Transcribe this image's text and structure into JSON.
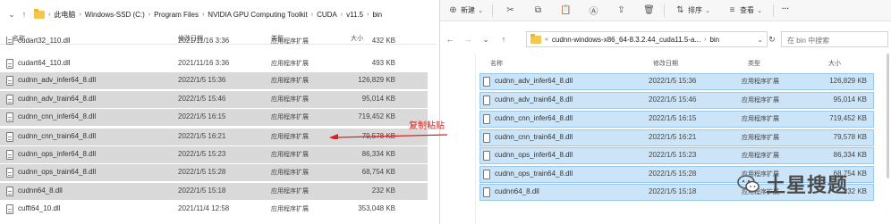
{
  "left": {
    "breadcrumb": [
      "此电脑",
      "Windows-SSD (C:)",
      "Program Files",
      "NVIDIA GPU Computing Toolkit",
      "CUDA",
      "v11.5",
      "bin"
    ],
    "headers": {
      "name": "名称",
      "date": "修改日期",
      "type": "类型",
      "size": "大小"
    },
    "rows": [
      {
        "name": "cudart32_110.dll",
        "date": "2021/11/16 3:36",
        "type": "应用程序扩展",
        "size": "432 KB",
        "selected": false
      },
      {
        "name": "cudart64_110.dll",
        "date": "2021/11/16 3:36",
        "type": "应用程序扩展",
        "size": "493 KB",
        "selected": false
      },
      {
        "name": "cudnn_adv_infer64_8.dll",
        "date": "2022/1/5 15:36",
        "type": "应用程序扩展",
        "size": "126,829 KB",
        "selected": true
      },
      {
        "name": "cudnn_adv_train64_8.dll",
        "date": "2022/1/5 15:46",
        "type": "应用程序扩展",
        "size": "95,014 KB",
        "selected": true
      },
      {
        "name": "cudnn_cnn_infer64_8.dll",
        "date": "2022/1/5 16:15",
        "type": "应用程序扩展",
        "size": "719,452 KB",
        "selected": true
      },
      {
        "name": "cudnn_cnn_train64_8.dll",
        "date": "2022/1/5 16:21",
        "type": "应用程序扩展",
        "size": "79,578 KB",
        "selected": true
      },
      {
        "name": "cudnn_ops_infer64_8.dll",
        "date": "2022/1/5 15:23",
        "type": "应用程序扩展",
        "size": "86,334 KB",
        "selected": true
      },
      {
        "name": "cudnn_ops_train64_8.dll",
        "date": "2022/1/5 15:28",
        "type": "应用程序扩展",
        "size": "68,754 KB",
        "selected": true
      },
      {
        "name": "cudnn64_8.dll",
        "date": "2022/1/5 15:18",
        "type": "应用程序扩展",
        "size": "232 KB",
        "selected": true
      },
      {
        "name": "cufft64_10.dll",
        "date": "2021/11/4 12:58",
        "type": "应用程序扩展",
        "size": "353,048 KB",
        "selected": false
      }
    ]
  },
  "annotation": {
    "label": "复制粘贴",
    "color": "#e0201f"
  },
  "right": {
    "toolbar": {
      "new_label": "新建",
      "sort_label": "排序",
      "view_label": "查看",
      "more_label": "···"
    },
    "address": [
      "cudnn-windows-x86_64-8.3.2.44_cuda11.5-a...",
      "bin"
    ],
    "search_placeholder": "在 bin 中搜索",
    "headers": {
      "name": "名称",
      "date": "修改日期",
      "type": "类型",
      "size": "大小"
    },
    "rows": [
      {
        "name": "cudnn_adv_infer64_8.dll",
        "date": "2022/1/5 15:36",
        "type": "应用程序扩展",
        "size": "126,829 KB"
      },
      {
        "name": "cudnn_adv_train64_8.dll",
        "date": "2022/1/5 15:46",
        "type": "应用程序扩展",
        "size": "95,014 KB"
      },
      {
        "name": "cudnn_cnn_infer64_8.dll",
        "date": "2022/1/5 16:15",
        "type": "应用程序扩展",
        "size": "719,452 KB"
      },
      {
        "name": "cudnn_cnn_train64_8.dll",
        "date": "2022/1/5 16:21",
        "type": "应用程序扩展",
        "size": "79,578 KB"
      },
      {
        "name": "cudnn_ops_infer64_8.dll",
        "date": "2022/1/5 15:23",
        "type": "应用程序扩展",
        "size": "86,334 KB"
      },
      {
        "name": "cudnn_ops_train64_8.dll",
        "date": "2022/1/5 15:28",
        "type": "应用程序扩展",
        "size": "68,754 KB"
      },
      {
        "name": "cudnn64_8.dll",
        "date": "2022/1/5 15:18",
        "type": "应用程序扩展",
        "size": "232 KB"
      }
    ]
  },
  "watermark": {
    "text": "土星搜题"
  },
  "colors": {
    "left_selected": "#d9d9d9",
    "right_selected": "#cce4f7",
    "right_selected_border": "#99c9ef",
    "folder": "#f3c74c"
  }
}
